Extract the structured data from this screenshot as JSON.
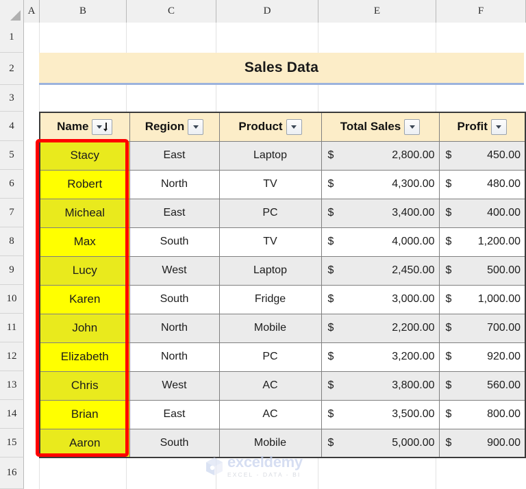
{
  "spreadsheet": {
    "column_headers": [
      "A",
      "B",
      "C",
      "D",
      "E",
      "F"
    ],
    "row_headers": [
      "1",
      "2",
      "3",
      "4",
      "5",
      "6",
      "7",
      "8",
      "9",
      "10",
      "11",
      "12",
      "13",
      "14",
      "15",
      "16"
    ],
    "select_all_icon": "select-all-triangle-icon"
  },
  "title": {
    "text": "Sales Data"
  },
  "table": {
    "headers": [
      {
        "label": "Name",
        "filter": "filter-dropdown-sorted-icon"
      },
      {
        "label": "Region",
        "filter": "filter-dropdown-icon"
      },
      {
        "label": "Product",
        "filter": "filter-dropdown-icon"
      },
      {
        "label": "Total Sales",
        "filter": "filter-dropdown-icon"
      },
      {
        "label": "Profit",
        "filter": "filter-dropdown-icon"
      }
    ],
    "currency_symbol": "$",
    "rows": [
      {
        "name": "Stacy",
        "region": "East",
        "product": "Laptop",
        "total_sales": "2,800.00",
        "profit": "450.00"
      },
      {
        "name": "Robert",
        "region": "North",
        "product": "TV",
        "total_sales": "4,300.00",
        "profit": "480.00"
      },
      {
        "name": "Micheal",
        "region": "East",
        "product": "PC",
        "total_sales": "3,400.00",
        "profit": "400.00"
      },
      {
        "name": "Max",
        "region": "South",
        "product": "TV",
        "total_sales": "4,000.00",
        "profit": "1,200.00"
      },
      {
        "name": "Lucy",
        "region": "West",
        "product": "Laptop",
        "total_sales": "2,450.00",
        "profit": "500.00"
      },
      {
        "name": "Karen",
        "region": "South",
        "product": "Fridge",
        "total_sales": "3,000.00",
        "profit": "1,000.00"
      },
      {
        "name": "John",
        "region": "North",
        "product": "Mobile",
        "total_sales": "2,200.00",
        "profit": "700.00"
      },
      {
        "name": "Elizabeth",
        "region": "North",
        "product": "PC",
        "total_sales": "3,200.00",
        "profit": "920.00"
      },
      {
        "name": "Chris",
        "region": "West",
        "product": "AC",
        "total_sales": "3,800.00",
        "profit": "560.00"
      },
      {
        "name": "Brian",
        "region": "East",
        "product": "AC",
        "total_sales": "3,500.00",
        "profit": "800.00"
      },
      {
        "name": "Aaron",
        "region": "South",
        "product": "Mobile",
        "total_sales": "5,000.00",
        "profit": "900.00"
      }
    ]
  },
  "highlight": {
    "target_column": "Name",
    "color": "#ff0000"
  },
  "watermark": {
    "name": "exceldemy",
    "tagline": "EXCEL - DATA - BI"
  },
  "colors": {
    "header_fill": "#fcedc8",
    "name_fill": "#ffff00",
    "name_fill_banded": "#e9ea1d",
    "band_fill": "#ebebeb",
    "grid_header": "#f0f0f0",
    "title_underline": "#9cb3dd"
  }
}
